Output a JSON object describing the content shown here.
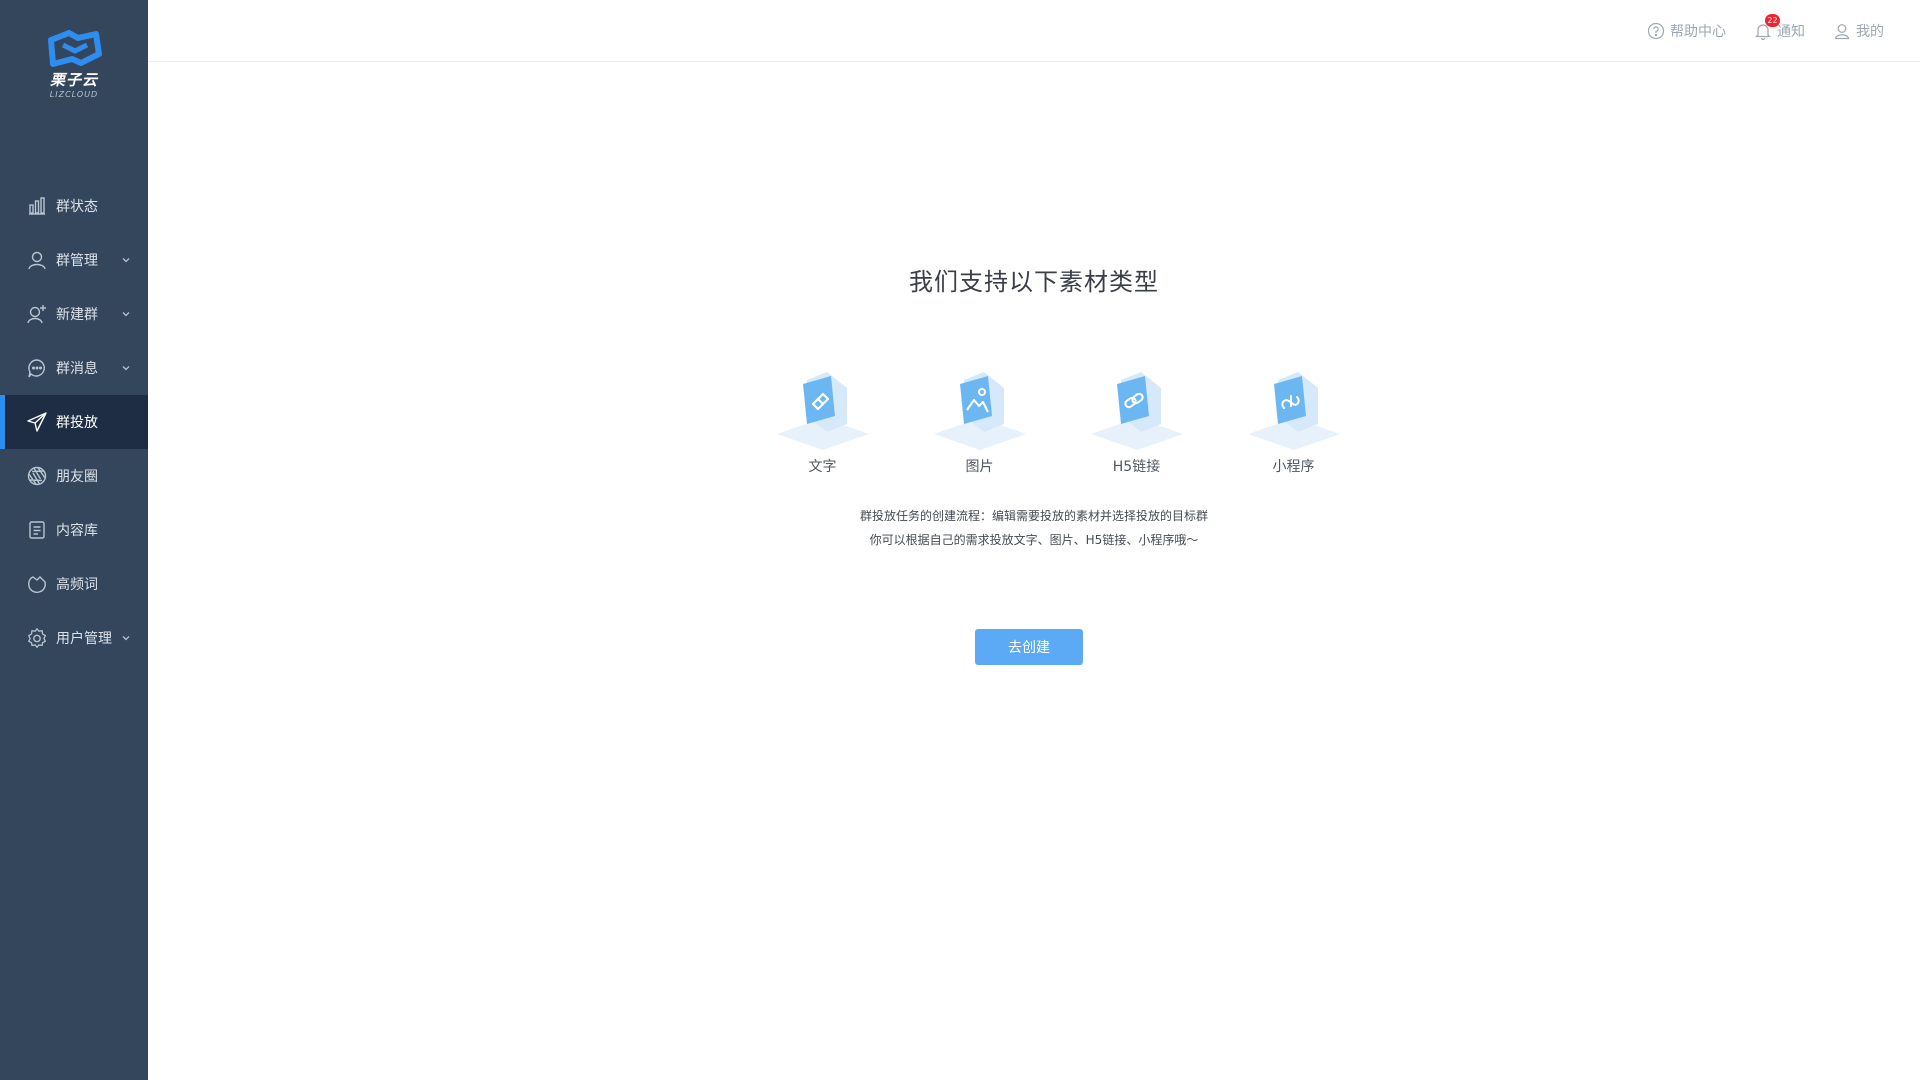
{
  "brand": {
    "name": "栗子云",
    "sub": "LIZCLOUD",
    "accent": "#2f8cf0"
  },
  "sidebar": {
    "items": [
      {
        "label": "群状态",
        "icon": "bar-chart-icon",
        "expandable": false
      },
      {
        "label": "群管理",
        "icon": "user-icon",
        "expandable": true
      },
      {
        "label": "新建群",
        "icon": "user-add-icon",
        "expandable": true
      },
      {
        "label": "群消息",
        "icon": "chat-icon",
        "expandable": true
      },
      {
        "label": "群投放",
        "icon": "send-icon",
        "expandable": false,
        "active": true
      },
      {
        "label": "朋友圈",
        "icon": "aperture-icon",
        "expandable": false
      },
      {
        "label": "内容库",
        "icon": "document-icon",
        "expandable": false
      },
      {
        "label": "高频词",
        "icon": "tag-icon",
        "expandable": false
      },
      {
        "label": "用户管理",
        "icon": "gear-icon",
        "expandable": true
      }
    ]
  },
  "header": {
    "help": "帮助中心",
    "notify": "通知",
    "notify_badge": "22",
    "mine": "我的"
  },
  "main": {
    "title": "我们支持以下素材类型",
    "types": [
      {
        "label": "文字",
        "icon": "eraser-icon"
      },
      {
        "label": "图片",
        "icon": "image-icon"
      },
      {
        "label": "H5链接",
        "icon": "link-icon"
      },
      {
        "label": "小程序",
        "icon": "mini-program-icon"
      }
    ],
    "desc_line1": "群投放任务的创建流程：编辑需要投放的素材并选择投放的目标群",
    "desc_line2": "你可以根据自己的需求投放文字、图片、H5链接、小程序哦～",
    "create_button": "去创建"
  }
}
